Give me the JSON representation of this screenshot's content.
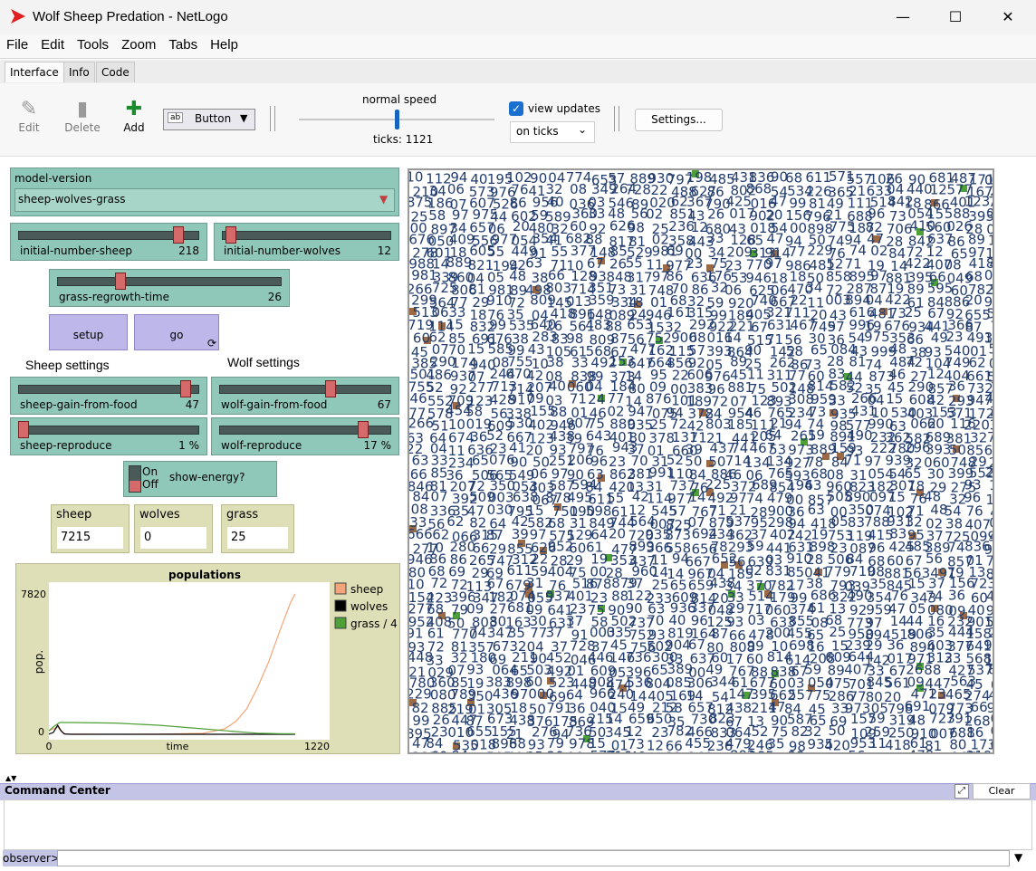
{
  "window": {
    "title": "Wolf Sheep Predation - NetLogo",
    "minimize_glyph": "—",
    "maximize_glyph": "☐",
    "close_glyph": "✕"
  },
  "menu": [
    "File",
    "Edit",
    "Tools",
    "Zoom",
    "Tabs",
    "Help"
  ],
  "tabs": [
    "Interface",
    "Info",
    "Code"
  ],
  "toolbar": {
    "edit": "Edit",
    "delete": "Delete",
    "add": "Add",
    "widget_type": "Button",
    "speed_label": "normal speed",
    "speed_fraction": 0.5,
    "ticks_text": "ticks: 1121",
    "view_updates_label": "view updates",
    "view_updates_checked": true,
    "update_mode": "on ticks",
    "settings": "Settings..."
  },
  "chooser": {
    "label": "model-version",
    "value": "sheep-wolves-grass"
  },
  "sliders": [
    {
      "label": "initial-number-sheep",
      "value": "218",
      "fraction": 0.9
    },
    {
      "label": "initial-number-wolves",
      "value": "12",
      "fraction": 0.02
    },
    {
      "label": "grass-regrowth-time",
      "value": "26",
      "fraction": 0.27
    },
    {
      "label": "sheep-gain-from-food",
      "value": "47",
      "fraction": 0.94
    },
    {
      "label": "wolf-gain-from-food",
      "value": "67",
      "fraction": 0.65
    },
    {
      "label": "sheep-reproduce",
      "value": "1 %",
      "fraction": 0.0
    },
    {
      "label": "wolf-reproduce",
      "value": "17 %",
      "fraction": 0.85
    }
  ],
  "buttons": {
    "setup": "setup",
    "go": "go"
  },
  "notes": {
    "sheep": "Sheep settings",
    "wolf": "Wolf settings"
  },
  "switch": {
    "label": "show-energy?",
    "on": "On",
    "off": "Off",
    "state": "off"
  },
  "monitors": [
    {
      "label": "sheep",
      "value": "7215"
    },
    {
      "label": "wolves",
      "value": "0"
    },
    {
      "label": "grass",
      "value": "25"
    }
  ],
  "chart_data": {
    "type": "line",
    "title": "populations",
    "xlabel": "time",
    "ylabel": "pop.",
    "xlim": [
      0,
      1220
    ],
    "ylim": [
      0,
      7820
    ],
    "x_tick_labels": [
      "0",
      "1220"
    ],
    "y_tick_labels": [
      "0",
      "7820"
    ],
    "legend_position": "right",
    "series": [
      {
        "name": "sheep",
        "color": "#f4a67a",
        "x": [
          0,
          40,
          60,
          80,
          120,
          300,
          500,
          700,
          800,
          850,
          900,
          950,
          1000,
          1050,
          1100,
          1121
        ],
        "y": [
          200,
          400,
          100,
          10,
          5,
          3,
          10,
          50,
          300,
          700,
          1400,
          2600,
          4000,
          5700,
          7300,
          7780
        ]
      },
      {
        "name": "wolves",
        "color": "#000000",
        "x": [
          0,
          20,
          40,
          55,
          70,
          100,
          300,
          600,
          900,
          1121
        ],
        "y": [
          12,
          100,
          500,
          200,
          20,
          0,
          0,
          0,
          0,
          0
        ]
      },
      {
        "name": "grass / 4",
        "color": "#4da036",
        "x": [
          0,
          30,
          50,
          100,
          300,
          500,
          700,
          850,
          950,
          1050,
          1121
        ],
        "y": [
          200,
          500,
          650,
          650,
          620,
          500,
          300,
          150,
          60,
          30,
          25
        ]
      }
    ]
  },
  "command_center": {
    "title": "Command Center",
    "clear": "Clear",
    "prompt": "observer>",
    "expand_icon": "expand-icon"
  }
}
